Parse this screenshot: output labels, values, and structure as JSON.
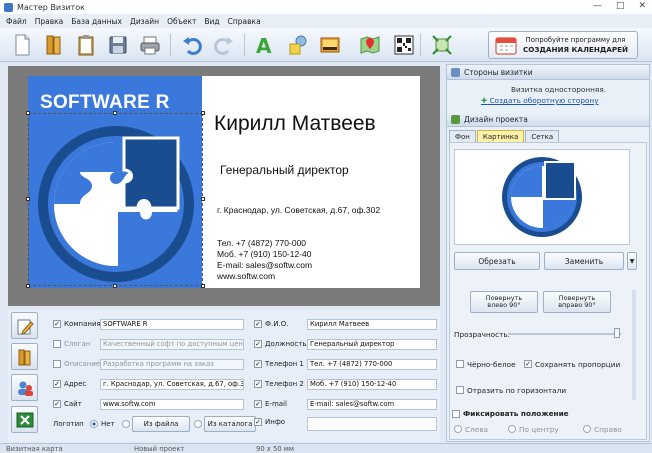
{
  "window": {
    "title": "Мастер Визиток"
  },
  "menu": [
    "Файл",
    "Правка",
    "База данных",
    "Дизайн",
    "Объект",
    "Вид",
    "Справка"
  ],
  "promo": {
    "line1": "Попробуйте программу для",
    "line2": "СОЗДАНИЯ КАЛЕНДАРЕЙ"
  },
  "card": {
    "logo_text": "SOFTWARE R",
    "name": "Кирилл Матвеев",
    "position": "Генеральный директор",
    "address": "г. Краснодар, ул. Советская, д.67, оф.302",
    "phone1": "Тел. +7 (4872) 770-000",
    "phone2": "Моб. +7 (910) 150-12-40",
    "email": "E-mail: sales@softw.com",
    "site": "www.softw.com",
    "colors": {
      "logo_bg": "#3b78dc",
      "ring": "#1a4d8f"
    }
  },
  "panel": {
    "sides_header": "Стороны визитки",
    "sides_info": "Визитка односторонняя.",
    "create_back_link": "Создать оборотную сторону",
    "design_header": "Дизайн проекта",
    "tabs": [
      {
        "label": "Фон"
      },
      {
        "label": "Картинка",
        "active": true
      },
      {
        "label": "Сетка"
      }
    ],
    "trim_button": "Обрезать",
    "replace_button": "Заменить",
    "rotate_left": [
      "Повернуть",
      "влево 90°"
    ],
    "rotate_right": [
      "Повернуть",
      "вправо 90°"
    ],
    "transparency_label": "Прозрачность:",
    "grayscale_label": "Чёрно-белое",
    "keep_ratio_label": "Сохранять пропорции",
    "flip_label": "Отразить по горизонтали",
    "fix_position_label": "Фиксировать положение",
    "align": [
      "Слева",
      "По центру",
      "Справо"
    ]
  },
  "form": {
    "company": {
      "label": "Компания",
      "value": "SOFTWARE R",
      "checked": true
    },
    "slogan": {
      "label": "Слоган",
      "placeholder": "Качественный софт по доступным ценам",
      "checked": false
    },
    "description": {
      "label": "Описание",
      "placeholder": "Разработка программ на заказ",
      "checked": false
    },
    "address": {
      "label": "Адрес",
      "value": "г. Краснодар, ул. Советская, д.67, оф.302",
      "checked": true
    },
    "site": {
      "label": "Сайт",
      "value": "www.softw.com",
      "checked": true
    },
    "logo": {
      "label": "Логотип",
      "none": "Нет",
      "from_file": "Из файла",
      "from_catalog": "Из каталога"
    },
    "fio": {
      "label": "Ф.И.О.",
      "value": "Кирилл Матвеев",
      "checked": true
    },
    "post": {
      "label": "Должность",
      "value": "Генеральный директор",
      "checked": true
    },
    "phone1": {
      "label": "Телефон 1",
      "value": "Тел. +7 (4872) 770-000",
      "checked": true
    },
    "phone2": {
      "label": "Телефон 2",
      "value": "Моб. +7 (910) 150-12-40",
      "checked": true
    },
    "email": {
      "label": "E-mail",
      "value": "E-mail: sales@softw.com",
      "checked": true
    },
    "info": {
      "label": "Инфо",
      "value": "",
      "checked": true
    }
  },
  "status": {
    "left": "Визитная карта",
    "middle": "Новый проект",
    "size": "90 x 50 мм"
  }
}
